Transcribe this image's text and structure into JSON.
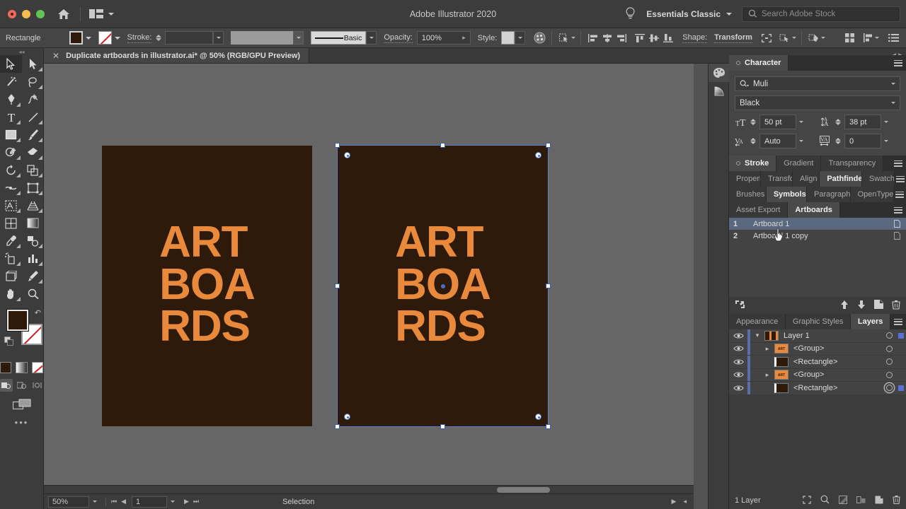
{
  "window": {
    "app_title": "Adobe Illustrator 2020",
    "workspace": "Essentials Classic",
    "search_placeholder": "Search Adobe Stock",
    "home_icon": "home-icon",
    "arrange_icon": "arrange-documents-icon",
    "bulb_icon": "lightbulb-icon",
    "search_icon": "search-icon"
  },
  "control_bar": {
    "object_label": "Rectangle",
    "fill_color": "#2e1a0a",
    "stroke_color": "none",
    "stroke_label": "Stroke:",
    "stroke_weight": "",
    "stroke_profile": "",
    "brush_label": "Basic",
    "opacity_label": "Opacity:",
    "opacity_value": "100%",
    "style_label": "Style:",
    "shape_label": "Shape:",
    "transform_label": "Transform",
    "icons": [
      "recolor-artwork-icon",
      "select-similar-icon",
      "align-left-icon",
      "align-center-horizontal-icon",
      "align-right-icon",
      "align-top-icon",
      "align-center-vertical-icon",
      "align-bottom-icon",
      "isolate-group-icon",
      "select-similar-objects-icon",
      "edit-toolbar-icon",
      "arrange-grid-icon",
      "distribute-icon",
      "panel-list-icon"
    ]
  },
  "document_tab": {
    "title": "Duplicate artboards in illustrator.ai* @ 50% (RGB/GPU Preview)",
    "close_icon": "close-icon"
  },
  "toolbar": {
    "tools": [
      "selection-tool",
      "direct-selection-tool",
      "magic-wand-tool",
      "lasso-tool",
      "pen-tool",
      "curvature-tool",
      "type-tool",
      "line-segment-tool",
      "rectangle-tool",
      "paintbrush-tool",
      "shaper-tool",
      "eraser-tool",
      "rotate-tool",
      "scale-tool",
      "width-tool",
      "free-transform-tool",
      "shape-builder-tool",
      "perspective-grid-tool",
      "mesh-tool",
      "gradient-tool",
      "eyedropper-tool",
      "blend-tool",
      "symbol-sprayer-tool",
      "column-graph-tool",
      "artboard-tool",
      "slice-tool",
      "hand-tool",
      "zoom-tool"
    ],
    "fill_color": "#2e1a0a",
    "stroke_color": "none",
    "modes": [
      "color-mode",
      "gradient-mode",
      "none-mode"
    ],
    "draw_modes": [
      "draw-normal",
      "draw-behind",
      "draw-inside"
    ],
    "screen_mode": "change-screen-mode",
    "more_tools": "edit-toolbar-ellipsis"
  },
  "canvas": {
    "background": "#666666",
    "artboards": [
      {
        "name": "Artboard 1",
        "fill": "#2e1a0a",
        "text": "ART\nBOA\nRDS",
        "text_color": "#e8893c",
        "selected": false
      },
      {
        "name": "Artboard 1 copy",
        "fill": "#2e1a0a",
        "text": "ART\nBOA\nRDS",
        "text_color": "#e8893c",
        "selected": true
      }
    ],
    "selection_color": "#5a7fd0"
  },
  "status_bar": {
    "zoom": "50%",
    "artboard_number": "1",
    "status_text": "Selection",
    "prev_first_icon": "first-artboard-icon",
    "prev_icon": "previous-artboard-icon",
    "next_icon": "next-artboard-icon",
    "last_icon": "last-artboard-icon"
  },
  "mini_dock": {
    "buttons": [
      "color-panel-icon",
      "gradient-panel-icon"
    ]
  },
  "panels": {
    "character": {
      "tab_label": "Character",
      "font_family": "Muli",
      "font_style": "Black",
      "font_size": "50 pt",
      "leading": "38 pt",
      "kerning": "Auto",
      "tracking": "0",
      "icons": {
        "search": "font-search-icon",
        "size": "font-size-icon",
        "leading": "leading-icon",
        "kerning": "kerning-icon",
        "tracking": "tracking-icon"
      }
    },
    "tab_rows": [
      {
        "tabs": [
          {
            "label": "Stroke",
            "active": true,
            "dot": true
          },
          {
            "label": "Gradient",
            "active": false
          },
          {
            "label": "Transparency",
            "active": false
          }
        ]
      },
      {
        "tabs": [
          {
            "label": "Properi",
            "active": false
          },
          {
            "label": "Transfo",
            "active": false
          },
          {
            "label": "Align",
            "active": false
          },
          {
            "label": "Pathfinder",
            "active": true
          },
          {
            "label": "Swatch",
            "active": false
          }
        ]
      },
      {
        "tabs": [
          {
            "label": "Brushes",
            "active": false
          },
          {
            "label": "Symbols",
            "active": true
          },
          {
            "label": "Paragraph",
            "active": false
          },
          {
            "label": "OpenType",
            "active": false
          }
        ]
      },
      {
        "tabs": [
          {
            "label": "Asset Export",
            "active": false
          },
          {
            "label": "Artboards",
            "active": true
          }
        ]
      }
    ],
    "artboards_panel": {
      "rows": [
        {
          "num": "1",
          "name": "Artboard 1",
          "selected": true
        },
        {
          "num": "2",
          "name": "Artboard 1 copy",
          "selected": false
        }
      ],
      "footer_icons": [
        "rearrange-artboards-icon",
        "move-up-icon",
        "move-down-icon",
        "new-artboard-icon",
        "delete-artboard-icon"
      ]
    },
    "layers_panel": {
      "tabs": [
        {
          "label": "Appearance",
          "active": false
        },
        {
          "label": "Graphic Styles",
          "active": false
        },
        {
          "label": "Layers",
          "active": true
        }
      ],
      "rows": [
        {
          "name": "Layer 1",
          "indent": 0,
          "twist": "down",
          "thumb": "layer",
          "target": "ring",
          "selected": true
        },
        {
          "name": "<Group>",
          "indent": 1,
          "twist": "right",
          "thumb": "group",
          "target": "ring",
          "selected": false
        },
        {
          "name": "<Rectangle>",
          "indent": 1,
          "twist": "",
          "thumb": "rect",
          "target": "ring",
          "selected": false
        },
        {
          "name": "<Group>",
          "indent": 1,
          "twist": "right",
          "thumb": "group",
          "target": "ring",
          "selected": false
        },
        {
          "name": "<Rectangle>",
          "indent": 1,
          "twist": "",
          "thumb": "rect",
          "target": "ring-double",
          "selected": true
        }
      ],
      "footer_label": "1 Layer",
      "footer_icons": [
        "locate-object-icon",
        "search-layer-icon",
        "make-clipping-mask-icon",
        "create-sublayer-icon",
        "new-layer-icon",
        "delete-layer-icon"
      ]
    }
  },
  "cursor": {
    "type": "pointing-hand-cursor"
  }
}
